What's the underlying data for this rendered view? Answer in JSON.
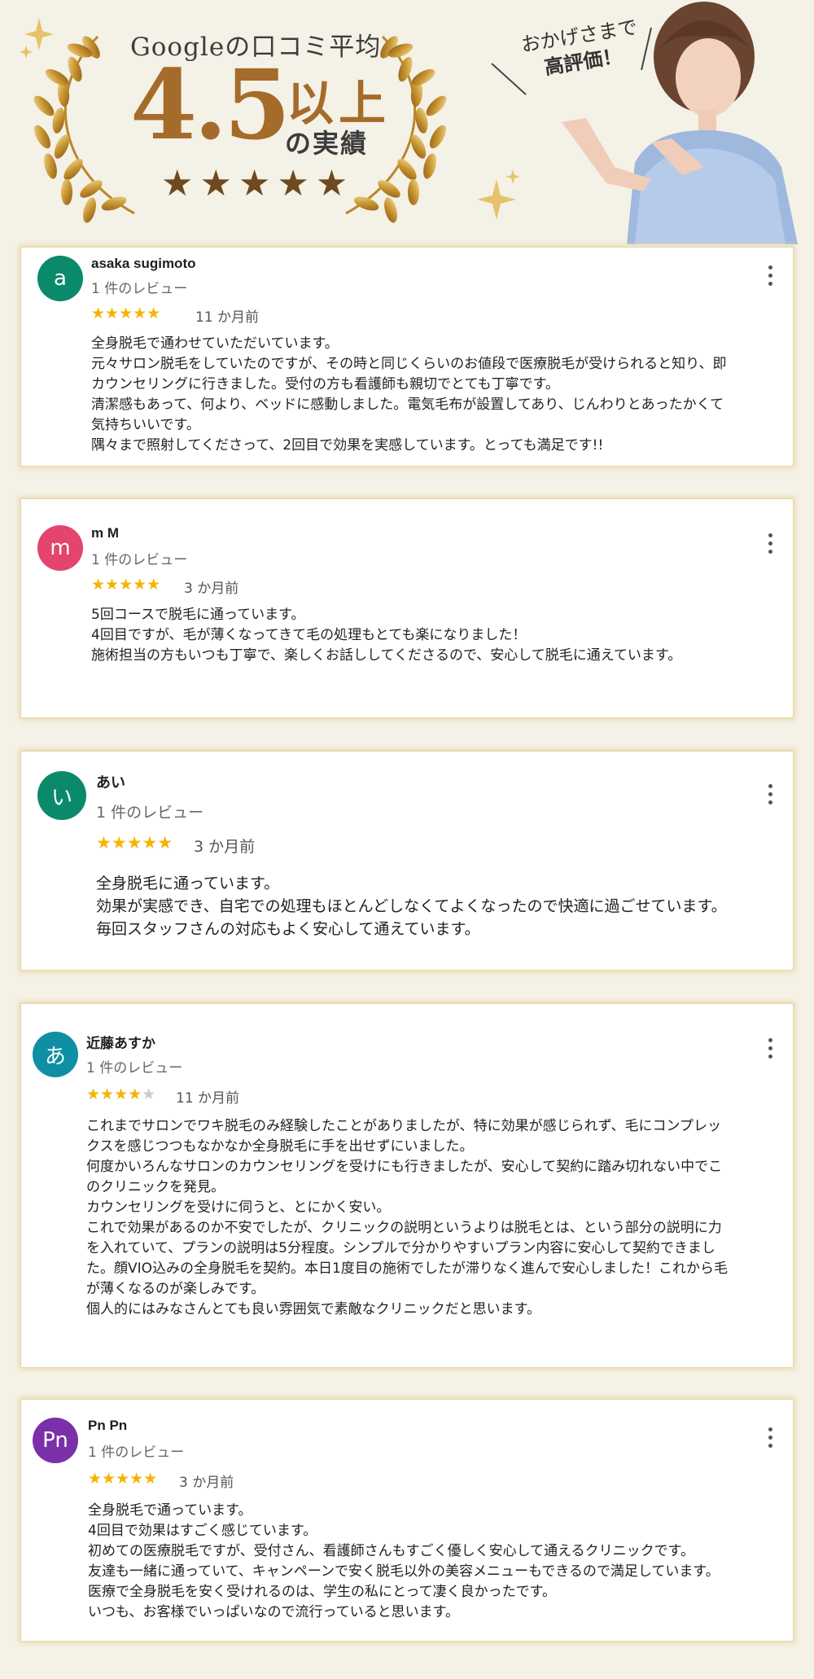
{
  "hero": {
    "title": "Googleの口コミ平均",
    "score": "4.5",
    "above": "以上",
    "achievement": "の実績",
    "stars": "★★★★★",
    "rating": 4.5,
    "bubble_line1": "おかげさまで",
    "bubble_line2": "高評価！"
  },
  "colors": {
    "gold": "#a56b2a",
    "star": "#f4b400",
    "background": "#f4f1e6"
  },
  "reviews": [
    {
      "initial": "a",
      "avatar_color": "#0b8a6b",
      "name": "asaka sugimoto",
      "review_count": "1 件のレビュー",
      "stars_on": "★★★★★",
      "stars_off": "",
      "rating": 5,
      "time": "11 か月前",
      "lines": [
        "全身脱毛で通わせていただいています。",
        "元々サロン脱毛をしていたのですが、その時と同じくらいのお値段で医療脱毛が受けられると知り、即",
        "カウンセリングに行きました。受付の方も看護師も親切でとても丁寧です。",
        "清潔感もあって、何より、ベッドに感動しました。電気毛布が設置してあり、じんわりとあったかくて",
        "気持ちいいです。",
        "隅々まで照射してくださって、2回目で効果を実感しています。とっても満足です!!"
      ]
    },
    {
      "initial": "m",
      "avatar_color": "#e5446d",
      "name": "m M",
      "review_count": "1 件のレビュー",
      "stars_on": "★★★★★",
      "stars_off": "",
      "rating": 5,
      "time": "3 か月前",
      "lines": [
        "5回コースで脱毛に通っています。",
        "4回目ですが、毛が薄くなってきて毛の処理もとても楽になりました！",
        "施術担当の方もいつも丁寧で、楽しくお話ししてくださるので、安心して脱毛に通えています。"
      ]
    },
    {
      "initial": "い",
      "avatar_color": "#0b8a6b",
      "name": "あい",
      "review_count": "1 件のレビュー",
      "stars_on": "★★★★★",
      "stars_off": "",
      "rating": 5,
      "time": "3 か月前",
      "lines": [
        "全身脱毛に通っています。",
        "効果が実感でき、自宅での処理もほとんどしなくてよくなったので快適に過ごせています。",
        "毎回スタッフさんの対応もよく安心して通えています。"
      ]
    },
    {
      "initial": "あ",
      "avatar_color": "#0e8fa3",
      "name": "近藤あすか",
      "review_count": "1 件のレビュー",
      "stars_on": "★★★★",
      "stars_off": "★",
      "rating": 4,
      "time": "11 か月前",
      "lines": [
        "これまでサロンでワキ脱毛のみ経験したことがありましたが、特に効果が感じられず、毛にコンプレッ",
        "クスを感じつつもなかなか全身脱毛に手を出せずにいました。",
        "何度かいろんなサロンのカウンセリングを受けにも行きましたが、安心して契約に踏み切れない中でこ",
        "のクリニックを発見。",
        "カウンセリングを受けに伺うと、とにかく安い。",
        "これで効果があるのか不安でしたが、クリニックの説明というよりは脱毛とは、という部分の説明に力",
        "を入れていて、プランの説明は5分程度。シンプルで分かりやすいプラン内容に安心して契約できまし",
        "た。顔VIO込みの全身脱毛を契約。本日1度目の施術でしたが滞りなく進んで安心しました！これから毛",
        "が薄くなるのが楽しみです。",
        "個人的にはみなさんとても良い雰囲気で素敵なクリニックだと思います。"
      ]
    },
    {
      "initial": "Pn",
      "avatar_color": "#7b2fa8",
      "name": "Pn Pn",
      "review_count": "1 件のレビュー",
      "stars_on": "★★★★★",
      "stars_off": "",
      "rating": 5,
      "time": "3 か月前",
      "lines": [
        "全身脱毛で通っています。",
        "4回目で効果はすごく感じています。",
        "初めての医療脱毛ですが、受付さん、看護師さんもすごく優しく安心して通えるクリニックです。",
        "友達も一緒に通っていて、キャンペーンで安く脱毛以外の美容メニューもできるので満足しています。",
        "医療で全身脱毛を安く受けれるのは、学生の私にとって凄く良かったです。",
        "いつも、お客様でいっぱいなので流行っていると思います。"
      ]
    }
  ]
}
